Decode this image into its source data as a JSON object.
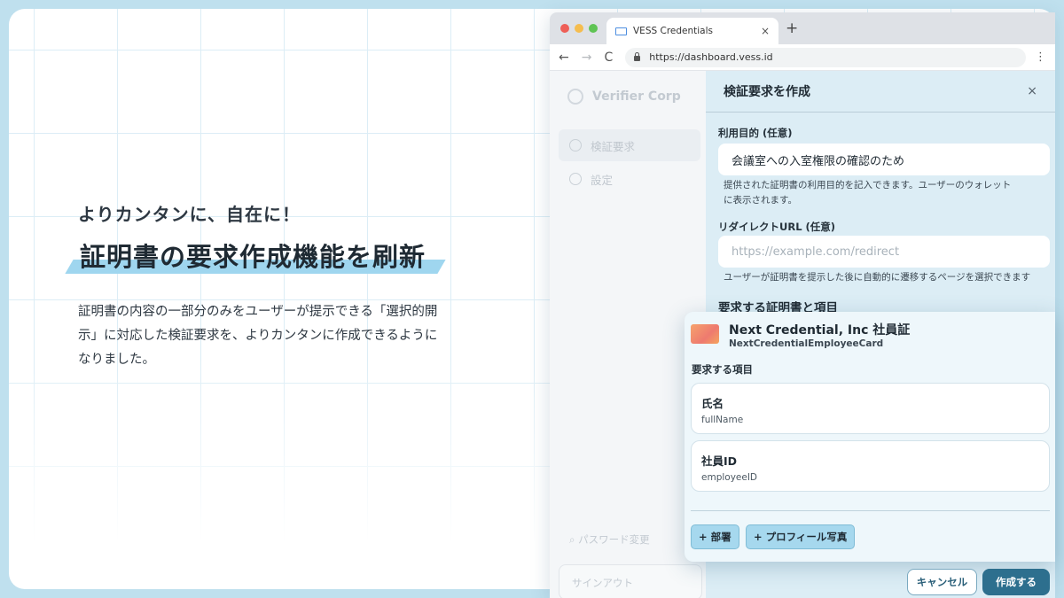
{
  "hero": {
    "subtitle": "よりカンタンに、自在に！",
    "title": "証明書の要求作成機能を刷新",
    "description": "証明書の内容の一部分のみをユーザーが提示できる「選択的開示」に対応した検証要求を、よりカンタンに作成できるようになりました。"
  },
  "browser": {
    "tab_title": "VESS Credentials",
    "tab_close": "×",
    "new_tab": "+",
    "back": "←",
    "forward": "→",
    "reload": "C",
    "url": "https://dashboard.vess.id",
    "menu": "⋮"
  },
  "sidebar": {
    "brand": "Verifier Corp",
    "items": [
      {
        "label": "検証要求"
      },
      {
        "label": "設定"
      }
    ],
    "password_change": "パスワード変更",
    "signout": "サインアウト"
  },
  "panel": {
    "title": "検証要求を作成",
    "close": "×",
    "purpose_label": "利用目的 (任意)",
    "purpose_value": "会議室への入室権限の確認のため",
    "purpose_hint_1": "提供された証明書の利用目的を記入できます。ユーザーのウォレット",
    "purpose_hint_2": "に表示されます。",
    "redirect_label": "リダイレクトURL (任意)",
    "redirect_placeholder": "https://example.com/redirect",
    "redirect_hint": "ユーザーが証明書を提示した後に自動的に遷移するページを選択できます",
    "section_title": "要求する証明書と項目"
  },
  "credential": {
    "name": "Next Credential, Inc 社員証",
    "type_id": "NextCredentialEmployeeCard",
    "items_label": "要求する項目",
    "items": [
      {
        "name": "氏名",
        "key": "fullName"
      },
      {
        "name": "社員ID",
        "key": "employeeID"
      }
    ],
    "add_chips": [
      {
        "label": "+ 部署"
      },
      {
        "label": "+ プロフィール写真"
      }
    ]
  },
  "actions": {
    "cancel": "キャンセル",
    "create": "作成する"
  },
  "colors": {
    "accent": "#2d6f8e",
    "chip": "#a6d8ee",
    "panel_bg": "#dcedf5"
  }
}
